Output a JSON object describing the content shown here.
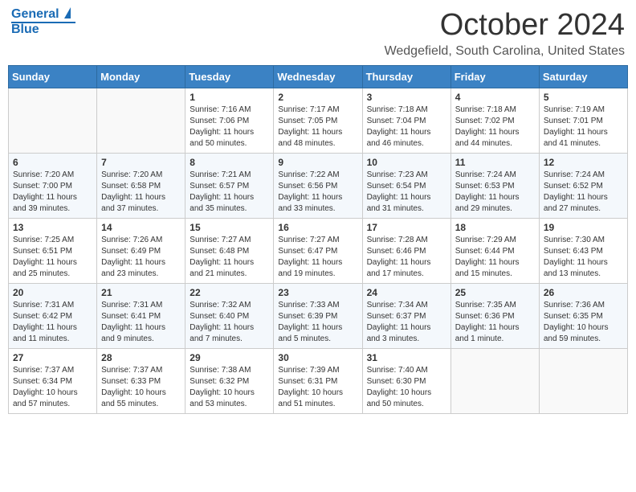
{
  "header": {
    "logo_line1": "General",
    "logo_line2": "Blue",
    "month": "October 2024",
    "location": "Wedgefield, South Carolina, United States"
  },
  "weekdays": [
    "Sunday",
    "Monday",
    "Tuesday",
    "Wednesday",
    "Thursday",
    "Friday",
    "Saturday"
  ],
  "weeks": [
    [
      {
        "day": "",
        "info": ""
      },
      {
        "day": "",
        "info": ""
      },
      {
        "day": "1",
        "info": "Sunrise: 7:16 AM\nSunset: 7:06 PM\nDaylight: 11 hours and 50 minutes."
      },
      {
        "day": "2",
        "info": "Sunrise: 7:17 AM\nSunset: 7:05 PM\nDaylight: 11 hours and 48 minutes."
      },
      {
        "day": "3",
        "info": "Sunrise: 7:18 AM\nSunset: 7:04 PM\nDaylight: 11 hours and 46 minutes."
      },
      {
        "day": "4",
        "info": "Sunrise: 7:18 AM\nSunset: 7:02 PM\nDaylight: 11 hours and 44 minutes."
      },
      {
        "day": "5",
        "info": "Sunrise: 7:19 AM\nSunset: 7:01 PM\nDaylight: 11 hours and 41 minutes."
      }
    ],
    [
      {
        "day": "6",
        "info": "Sunrise: 7:20 AM\nSunset: 7:00 PM\nDaylight: 11 hours and 39 minutes."
      },
      {
        "day": "7",
        "info": "Sunrise: 7:20 AM\nSunset: 6:58 PM\nDaylight: 11 hours and 37 minutes."
      },
      {
        "day": "8",
        "info": "Sunrise: 7:21 AM\nSunset: 6:57 PM\nDaylight: 11 hours and 35 minutes."
      },
      {
        "day": "9",
        "info": "Sunrise: 7:22 AM\nSunset: 6:56 PM\nDaylight: 11 hours and 33 minutes."
      },
      {
        "day": "10",
        "info": "Sunrise: 7:23 AM\nSunset: 6:54 PM\nDaylight: 11 hours and 31 minutes."
      },
      {
        "day": "11",
        "info": "Sunrise: 7:24 AM\nSunset: 6:53 PM\nDaylight: 11 hours and 29 minutes."
      },
      {
        "day": "12",
        "info": "Sunrise: 7:24 AM\nSunset: 6:52 PM\nDaylight: 11 hours and 27 minutes."
      }
    ],
    [
      {
        "day": "13",
        "info": "Sunrise: 7:25 AM\nSunset: 6:51 PM\nDaylight: 11 hours and 25 minutes."
      },
      {
        "day": "14",
        "info": "Sunrise: 7:26 AM\nSunset: 6:49 PM\nDaylight: 11 hours and 23 minutes."
      },
      {
        "day": "15",
        "info": "Sunrise: 7:27 AM\nSunset: 6:48 PM\nDaylight: 11 hours and 21 minutes."
      },
      {
        "day": "16",
        "info": "Sunrise: 7:27 AM\nSunset: 6:47 PM\nDaylight: 11 hours and 19 minutes."
      },
      {
        "day": "17",
        "info": "Sunrise: 7:28 AM\nSunset: 6:46 PM\nDaylight: 11 hours and 17 minutes."
      },
      {
        "day": "18",
        "info": "Sunrise: 7:29 AM\nSunset: 6:44 PM\nDaylight: 11 hours and 15 minutes."
      },
      {
        "day": "19",
        "info": "Sunrise: 7:30 AM\nSunset: 6:43 PM\nDaylight: 11 hours and 13 minutes."
      }
    ],
    [
      {
        "day": "20",
        "info": "Sunrise: 7:31 AM\nSunset: 6:42 PM\nDaylight: 11 hours and 11 minutes."
      },
      {
        "day": "21",
        "info": "Sunrise: 7:31 AM\nSunset: 6:41 PM\nDaylight: 11 hours and 9 minutes."
      },
      {
        "day": "22",
        "info": "Sunrise: 7:32 AM\nSunset: 6:40 PM\nDaylight: 11 hours and 7 minutes."
      },
      {
        "day": "23",
        "info": "Sunrise: 7:33 AM\nSunset: 6:39 PM\nDaylight: 11 hours and 5 minutes."
      },
      {
        "day": "24",
        "info": "Sunrise: 7:34 AM\nSunset: 6:37 PM\nDaylight: 11 hours and 3 minutes."
      },
      {
        "day": "25",
        "info": "Sunrise: 7:35 AM\nSunset: 6:36 PM\nDaylight: 11 hours and 1 minute."
      },
      {
        "day": "26",
        "info": "Sunrise: 7:36 AM\nSunset: 6:35 PM\nDaylight: 10 hours and 59 minutes."
      }
    ],
    [
      {
        "day": "27",
        "info": "Sunrise: 7:37 AM\nSunset: 6:34 PM\nDaylight: 10 hours and 57 minutes."
      },
      {
        "day": "28",
        "info": "Sunrise: 7:37 AM\nSunset: 6:33 PM\nDaylight: 10 hours and 55 minutes."
      },
      {
        "day": "29",
        "info": "Sunrise: 7:38 AM\nSunset: 6:32 PM\nDaylight: 10 hours and 53 minutes."
      },
      {
        "day": "30",
        "info": "Sunrise: 7:39 AM\nSunset: 6:31 PM\nDaylight: 10 hours and 51 minutes."
      },
      {
        "day": "31",
        "info": "Sunrise: 7:40 AM\nSunset: 6:30 PM\nDaylight: 10 hours and 50 minutes."
      },
      {
        "day": "",
        "info": ""
      },
      {
        "day": "",
        "info": ""
      }
    ]
  ]
}
